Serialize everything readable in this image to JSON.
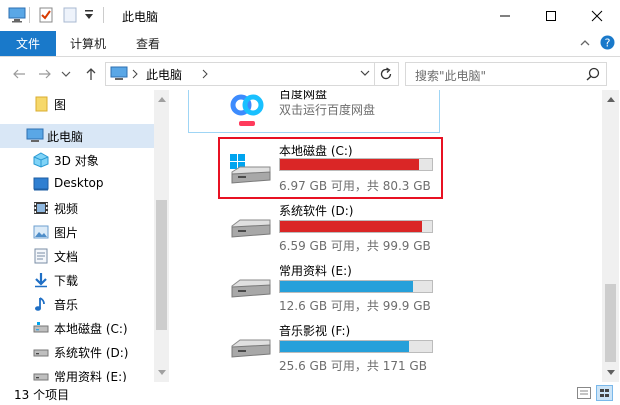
{
  "window": {
    "title": "此电脑",
    "qat_icons": [
      "computer-icon",
      "properties-checkmark-icon",
      "new-folder-icon",
      "qat-dropdown-icon"
    ]
  },
  "ribbon": {
    "tabs": [
      {
        "label": "文件"
      },
      {
        "label": "计算机"
      },
      {
        "label": "查看"
      }
    ]
  },
  "address": {
    "path": [
      "此电脑"
    ],
    "search_placeholder": "搜索\"此电脑\""
  },
  "nav": {
    "items": [
      {
        "label": "图",
        "icon": "folder-icon"
      },
      {
        "label": "此电脑",
        "icon": "this-pc-icon"
      },
      {
        "label": "3D 对象",
        "icon": "3d-objects-icon"
      },
      {
        "label": "Desktop",
        "icon": "desktop-icon"
      },
      {
        "label": "视频",
        "icon": "video-icon"
      },
      {
        "label": "图片",
        "icon": "pictures-icon"
      },
      {
        "label": "文档",
        "icon": "documents-icon"
      },
      {
        "label": "下载",
        "icon": "download-icon"
      },
      {
        "label": "音乐",
        "icon": "music-icon"
      },
      {
        "label": "本地磁盘 (C:)",
        "icon": "drive-icon"
      },
      {
        "label": "系统软件 (D:)",
        "icon": "drive-icon"
      },
      {
        "label": "常用资料 (E:)",
        "icon": "drive-icon"
      }
    ]
  },
  "content": {
    "app_item": {
      "name": "百度网盘",
      "desc": "双击运行百度网盘",
      "icon": "baidu-netdisk-icon"
    },
    "drives": [
      {
        "name": "本地磁盘 (C:)",
        "size_text": "6.97 GB 可用，共 80.3 GB",
        "used_fraction": 0.913,
        "bar_color": "#da2626",
        "icon": "windows-drive-icon",
        "highlighted": true
      },
      {
        "name": "系统软件 (D:)",
        "size_text": "6.59 GB 可用，共 99.9 GB",
        "used_fraction": 0.934,
        "bar_color": "#da2626",
        "icon": "drive-icon",
        "highlighted": false
      },
      {
        "name": "常用资料 (E:)",
        "size_text": "12.6 GB 可用，共 99.9 GB",
        "used_fraction": 0.874,
        "bar_color": "#26a0da",
        "icon": "drive-icon",
        "highlighted": false
      },
      {
        "name": "音乐影视 (F:)",
        "size_text": "25.6 GB 可用，共 171 GB",
        "used_fraction": 0.85,
        "bar_color": "#26a0da",
        "icon": "drive-icon",
        "highlighted": false
      }
    ]
  },
  "status": {
    "item_count": "13 个项目"
  },
  "colors": {
    "accent": "#1979ca",
    "highlight_box": "#e81123"
  }
}
